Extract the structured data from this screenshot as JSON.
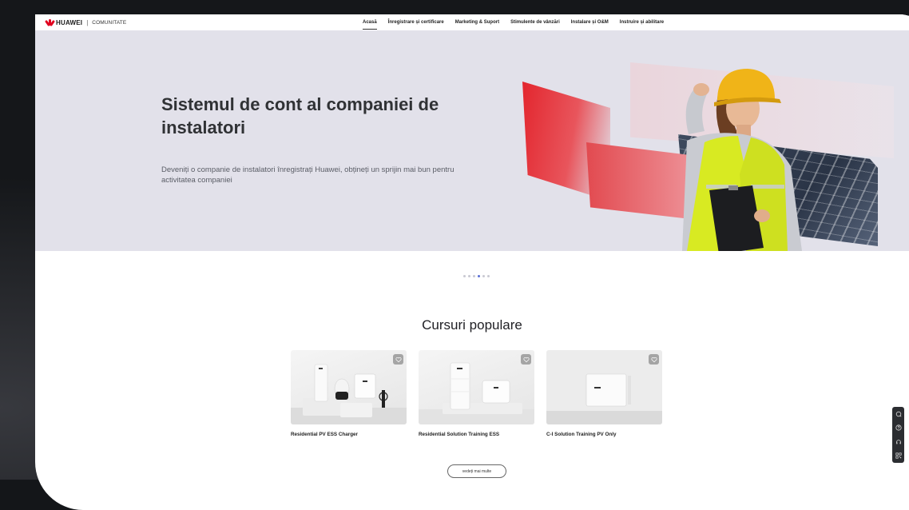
{
  "brand": {
    "name": "HUAWEI",
    "section": "COMUNITATE"
  },
  "nav": {
    "items": [
      {
        "label": "Acasă",
        "active": true
      },
      {
        "label": "Înregistrare și certificare"
      },
      {
        "label": "Marketing & Suport"
      },
      {
        "label": "Stimulente de vânzări"
      },
      {
        "label": "Instalare și O&M"
      },
      {
        "label": "Instruire și abilitare"
      }
    ]
  },
  "hero": {
    "title": "Sistemul de cont al companiei de instalatori",
    "description": "Deveniți o companie de instalatori înregistrați Huawei, obțineți un sprijin mai bun pentru activitatea companiei",
    "carousel": {
      "count": 6,
      "active_index": 3
    }
  },
  "courses": {
    "title": "Cursuri populare",
    "items": [
      {
        "title": "Residential PV ESS Charger",
        "icon": "heart-icon"
      },
      {
        "title": "Residential Solution Training ESS",
        "icon": "heart-icon"
      },
      {
        "title": "C-I Solution Training PV Only",
        "icon": "heart-icon"
      }
    ],
    "more_label": "vedeți mai multe"
  },
  "side_tools": [
    "chat-icon",
    "help-icon",
    "support-icon",
    "qr-icon"
  ],
  "colors": {
    "brand_red": "#e1001f",
    "hero_bg": "#e2e1ea",
    "page_bg": "#15171a",
    "carousel_active": "#5a6fd6"
  }
}
